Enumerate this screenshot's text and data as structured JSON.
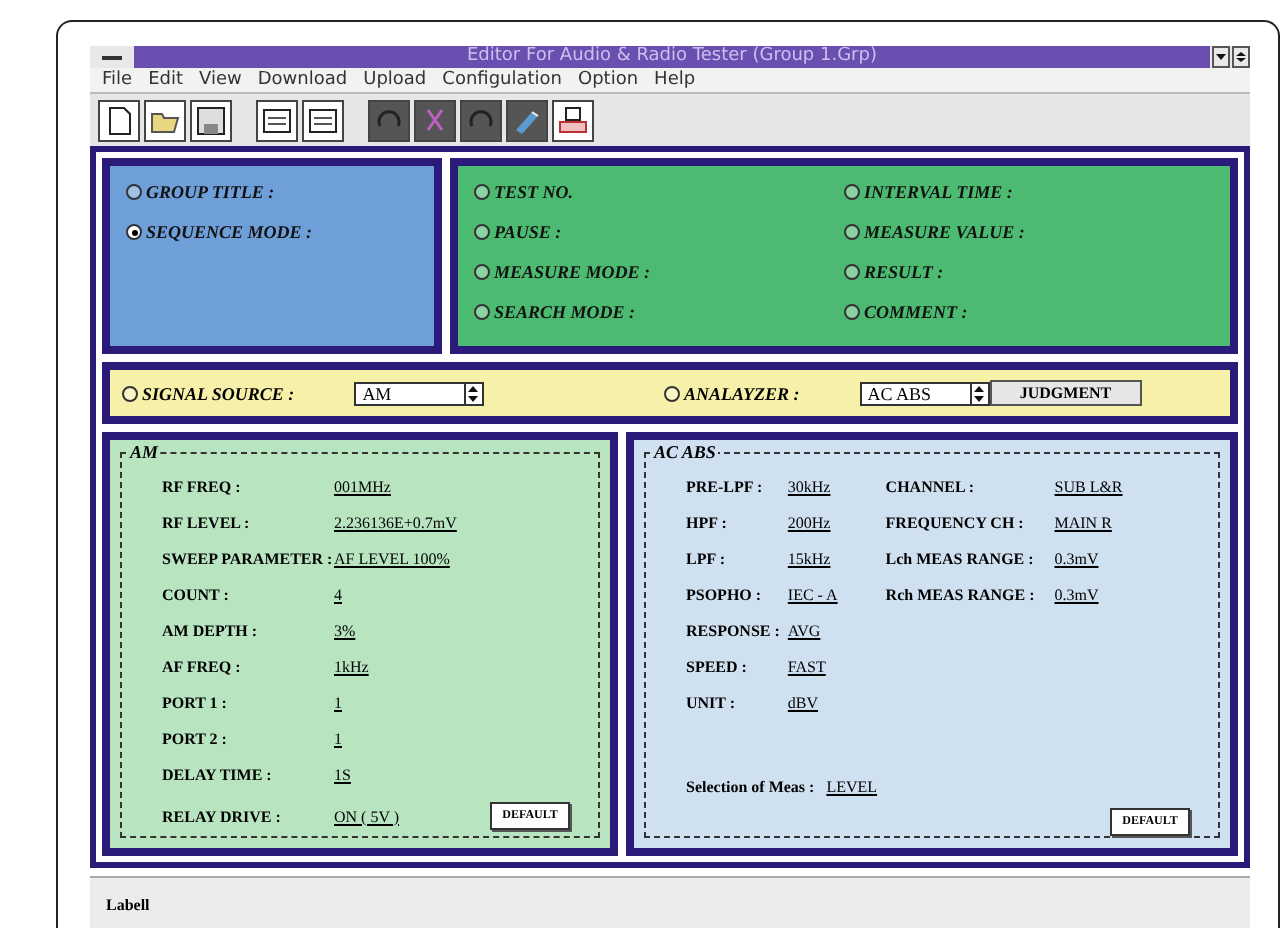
{
  "window": {
    "title": "Editor For Audio & Radio Tester (Group 1.Grp)"
  },
  "menu": [
    "File",
    "Edit",
    "View",
    "Download",
    "Upload",
    "Configulation",
    "Option",
    "Help"
  ],
  "group_panel": [
    {
      "label": "GROUP TITLE :",
      "selected": false
    },
    {
      "label": "SEQUENCE MODE :",
      "selected": true
    }
  ],
  "display_panel": [
    {
      "label": "TEST NO.",
      "selected": false
    },
    {
      "label": "INTERVAL TIME :",
      "selected": false
    },
    {
      "label": "PAUSE :",
      "selected": false
    },
    {
      "label": "MEASURE VALUE :",
      "selected": false
    },
    {
      "label": "MEASURE MODE :",
      "selected": false
    },
    {
      "label": "RESULT :",
      "selected": false
    },
    {
      "label": "SEARCH MODE :",
      "selected": false
    },
    {
      "label": "COMMENT :",
      "selected": false
    }
  ],
  "signal_bar": {
    "signal_source": {
      "label": "SIGNAL SOURCE :",
      "selected": false,
      "value": "AM"
    },
    "analyzer": {
      "label": "ANALAYZER :",
      "selected": false,
      "value": "AC ABS"
    },
    "button": "JUDGMENT"
  },
  "am_group": {
    "title": "AM",
    "rows": [
      {
        "label": "RF FREQ :",
        "value": "001MHz"
      },
      {
        "label": "RF LEVEL :",
        "value": "2.236136E+0.7mV"
      },
      {
        "label": "SWEEP PARAMETER :",
        "value": "AF LEVEL 100%"
      },
      {
        "label": "COUNT :",
        "value": "4"
      },
      {
        "label": "AM DEPTH :",
        "value": "3%"
      },
      {
        "label": "AF FREQ :",
        "value": "1kHz"
      },
      {
        "label": "PORT 1 :",
        "value": "1"
      },
      {
        "label": "PORT 2 :",
        "value": "1"
      },
      {
        "label": "DELAY TIME :",
        "value": "1S"
      },
      {
        "label": "RELAY DRIVE :",
        "value": "ON ( 5V )"
      }
    ],
    "button": "DEFAULT"
  },
  "analyzer_group": {
    "title": "AC ABS",
    "left_rows": [
      {
        "label": "PRE-LPF :",
        "value": "30kHz"
      },
      {
        "label": "HPF :",
        "value": "200Hz"
      },
      {
        "label": "LPF :",
        "value": "15kHz"
      },
      {
        "label": "PSOPHO :",
        "value": "IEC - A"
      },
      {
        "label": "RESPONSE :",
        "value": "AVG"
      },
      {
        "label": "SPEED :",
        "value": "FAST"
      },
      {
        "label": "UNIT :",
        "value": "dBV"
      }
    ],
    "right_rows": [
      {
        "label": "CHANNEL :",
        "value": "SUB L&R"
      },
      {
        "label": "FREQUENCY CH :",
        "value": "MAIN R"
      },
      {
        "label": "Lch MEAS RANGE :",
        "value": "0.3mV"
      },
      {
        "label": "Rch MEAS RANGE :",
        "value": "0.3mV"
      }
    ],
    "selection": {
      "label": "Selection of Meas :",
      "value": "LEVEL"
    },
    "button": "DEFAULT"
  },
  "status_bar": {
    "label": "Labell"
  }
}
